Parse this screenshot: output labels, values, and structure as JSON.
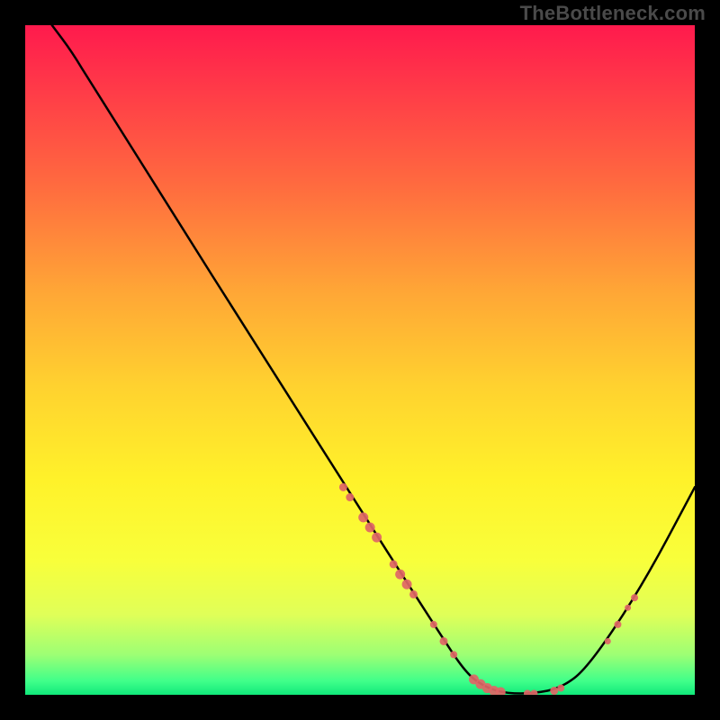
{
  "watermark": "TheBottleneck.com",
  "chart_data": {
    "type": "line",
    "title": "",
    "xlabel": "",
    "ylabel": "",
    "x_range": [
      0,
      100
    ],
    "y_range": [
      0,
      100
    ],
    "curve": [
      {
        "x": 4,
        "y": 100
      },
      {
        "x": 7,
        "y": 96
      },
      {
        "x": 10,
        "y": 91
      },
      {
        "x": 46,
        "y": 34
      },
      {
        "x": 62,
        "y": 9
      },
      {
        "x": 66,
        "y": 3
      },
      {
        "x": 69,
        "y": 1
      },
      {
        "x": 72,
        "y": 0.2
      },
      {
        "x": 76,
        "y": 0.2
      },
      {
        "x": 80,
        "y": 1
      },
      {
        "x": 84,
        "y": 4
      },
      {
        "x": 92,
        "y": 16
      },
      {
        "x": 100,
        "y": 31
      }
    ],
    "markers": [
      {
        "x": 47.5,
        "y": 31,
        "r": 4.5
      },
      {
        "x": 48.5,
        "y": 29.5,
        "r": 4.5
      },
      {
        "x": 50.5,
        "y": 26.5,
        "r": 5.5
      },
      {
        "x": 51.5,
        "y": 25,
        "r": 5.5
      },
      {
        "x": 52.5,
        "y": 23.5,
        "r": 5.5
      },
      {
        "x": 55,
        "y": 19.5,
        "r": 4.5
      },
      {
        "x": 56,
        "y": 18,
        "r": 5.5
      },
      {
        "x": 57,
        "y": 16.5,
        "r": 5.5
      },
      {
        "x": 58,
        "y": 15,
        "r": 4.5
      },
      {
        "x": 61,
        "y": 10.5,
        "r": 4
      },
      {
        "x": 62.5,
        "y": 8,
        "r": 4.5
      },
      {
        "x": 64,
        "y": 6,
        "r": 4
      },
      {
        "x": 67,
        "y": 2.3,
        "r": 5.5
      },
      {
        "x": 68,
        "y": 1.6,
        "r": 5.5
      },
      {
        "x": 69,
        "y": 1,
        "r": 5.5
      },
      {
        "x": 70,
        "y": 0.6,
        "r": 5.5
      },
      {
        "x": 71,
        "y": 0.4,
        "r": 5.5
      },
      {
        "x": 75,
        "y": 0.2,
        "r": 4
      },
      {
        "x": 76,
        "y": 0.2,
        "r": 4
      },
      {
        "x": 79,
        "y": 0.6,
        "r": 4.5
      },
      {
        "x": 80,
        "y": 1,
        "r": 4
      },
      {
        "x": 87,
        "y": 8,
        "r": 3.5
      },
      {
        "x": 88.5,
        "y": 10.5,
        "r": 4
      },
      {
        "x": 90,
        "y": 13,
        "r": 3.5
      },
      {
        "x": 91,
        "y": 14.5,
        "r": 4
      }
    ],
    "marker_color": "#e06666",
    "curve_color": "#000000"
  }
}
